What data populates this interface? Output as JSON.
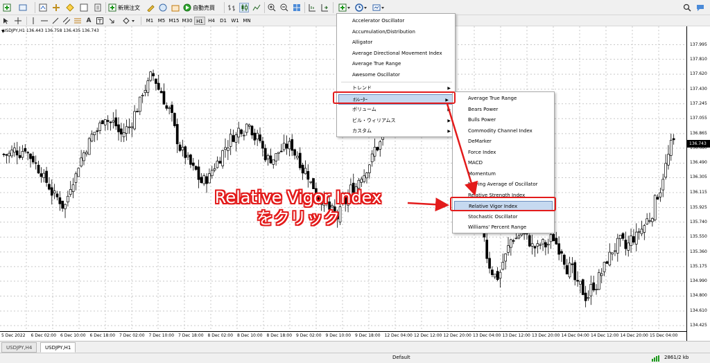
{
  "toolbar": {
    "new_order": "新規注文",
    "auto_trading": "自動売買"
  },
  "timeframes": [
    "M1",
    "M5",
    "M15",
    "M30",
    "H1",
    "H4",
    "D1",
    "W1",
    "MN"
  ],
  "active_timeframe": "H1",
  "chart": {
    "symbol_info": "USDJPY,H1  136.443 136.758 136.435 136.743",
    "current_price": "136.743"
  },
  "chart_data": {
    "type": "candlestick",
    "symbol": "USDJPY",
    "timeframe": "H1",
    "ylim": [
      134.425,
      138.07
    ],
    "price_ticks": [
      "137.995",
      "137.810",
      "137.620",
      "137.430",
      "137.245",
      "137.055",
      "136.865",
      "136.680",
      "136.490",
      "136.305",
      "136.115",
      "135.925",
      "135.740",
      "135.550",
      "135.360",
      "135.175",
      "134.990",
      "134.800",
      "134.610",
      "134.425"
    ],
    "time_ticks": [
      "5 Dec 2022",
      "6 Dec 02:00",
      "6 Dec 10:00",
      "6 Dec 18:00",
      "7 Dec 02:00",
      "7 Dec 10:00",
      "7 Dec 18:00",
      "8 Dec 02:00",
      "8 Dec 10:00",
      "8 Dec 18:00",
      "9 Dec 02:00",
      "9 Dec 10:00",
      "9 Dec 18:00",
      "12 Dec 04:00",
      "12 Dec 12:00",
      "12 Dec 20:00",
      "13 Dec 04:00",
      "13 Dec 12:00",
      "13 Dec 20:00",
      "14 Dec 04:00",
      "14 Dec 12:00",
      "14 Dec 20:00",
      "15 Dec 04:00"
    ],
    "closes": [
      136.6,
      136.65,
      136.7,
      136.55,
      136.4,
      136.2,
      136.05,
      135.95,
      136.3,
      136.55,
      136.75,
      136.9,
      137.1,
      137.0,
      136.85,
      136.95,
      137.2,
      137.45,
      137.6,
      137.4,
      137.15,
      136.8,
      136.6,
      136.4,
      136.25,
      136.3,
      136.5,
      136.7,
      136.85,
      136.95,
      137.05,
      136.8,
      136.6,
      136.55,
      136.65,
      136.7,
      136.6,
      136.4,
      136.2,
      136.05,
      135.9,
      135.8,
      136.0,
      136.2,
      136.35,
      136.5,
      136.7,
      136.9,
      137.1,
      137.35,
      137.55,
      137.7,
      137.6,
      137.45,
      137.3,
      137.1,
      136.8,
      136.5,
      136.2,
      135.7,
      135.2,
      135.05,
      135.3,
      135.55,
      135.6,
      135.5,
      135.4,
      135.45,
      135.55,
      135.4,
      135.15,
      134.9,
      134.8,
      134.95,
      135.1,
      135.3,
      135.45,
      135.4,
      135.55,
      135.65,
      135.8,
      136.1,
      136.45,
      136.75
    ]
  },
  "menus": {
    "main_items": [
      "Accelerator Oscillator",
      "Accumulation/Distribution",
      "Alligator",
      "Average Directional Movement Index",
      "Average True Range",
      "Awesome Oscillator"
    ],
    "categories": [
      "トレンド",
      "ｵｼﾚｰﾀｰ",
      "ボリューム",
      "ビル・ウィリアムス",
      "カスタム"
    ],
    "sub_items": [
      "Average True Range",
      "Bears Power",
      "Bulls Power",
      "Commodity Channel Index",
      "DeMarker",
      "Force Index",
      "MACD",
      "Momentum",
      "Moving Average of Oscillator",
      "Relative Strength Index",
      "Relative Vigor Index",
      "Stochastic Oscillator",
      "Williams' Percent Range"
    ],
    "highlighted_category": "ｵｼﾚｰﾀｰ",
    "highlighted_sub": "Relative Vigor Index"
  },
  "callout": {
    "line1": "Relative Vigor Index",
    "line2": "をクリック"
  },
  "tabs": [
    "USDJPY,H4",
    "USDJPY,H1"
  ],
  "active_tab": "USDJPY,H1",
  "status": {
    "profile": "Default",
    "traffic": "2861/2 kb"
  },
  "colors": {
    "highlight": "#e31b1b",
    "selection": "#c6d9f0",
    "candle": "#000000"
  }
}
